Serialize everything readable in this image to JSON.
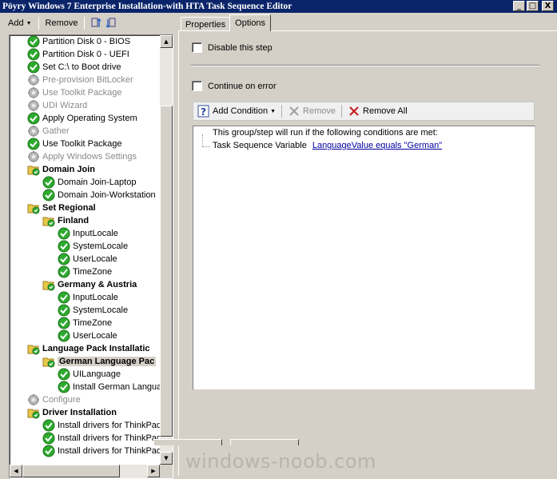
{
  "window": {
    "title": "Pöyry Windows 7 Enterprise Installation-with HTA Task Sequence Editor",
    "min_label": "_",
    "max_label": "□",
    "close_label": "X"
  },
  "toolbar": {
    "add_label": "Add",
    "remove_label": "Remove"
  },
  "tree": {
    "rows": [
      {
        "label": "Partition Disk 0 - BIOS",
        "icon": "check-icon",
        "indent": 0,
        "type": "step"
      },
      {
        "label": "Partition Disk 0 - UEFI",
        "icon": "check-icon",
        "indent": 0,
        "type": "step"
      },
      {
        "label": "Set C:\\ to Boot drive",
        "icon": "check-icon",
        "indent": 0,
        "type": "step"
      },
      {
        "label": "Pre-provision BitLocker",
        "icon": "disabled-gear-icon",
        "indent": 0,
        "type": "disabled"
      },
      {
        "label": "Use Toolkit Package",
        "icon": "disabled-gear-icon",
        "indent": 0,
        "type": "disabled"
      },
      {
        "label": "UDI Wizard",
        "icon": "disabled-gear-icon",
        "indent": 0,
        "type": "disabled"
      },
      {
        "label": "Apply Operating System",
        "icon": "check-icon",
        "indent": 0,
        "type": "step"
      },
      {
        "label": "Gather",
        "icon": "disabled-gear-icon",
        "indent": 0,
        "type": "disabled"
      },
      {
        "label": "Use Toolkit Package",
        "icon": "check-icon",
        "indent": 0,
        "type": "step"
      },
      {
        "label": "Apply Windows Settings",
        "icon": "disabled-gear-icon",
        "indent": 0,
        "type": "disabled"
      },
      {
        "label": "Domain Join",
        "icon": "folder-check-icon",
        "indent": 0,
        "type": "group"
      },
      {
        "label": "Domain Join-Laptop",
        "icon": "check-icon",
        "indent": 1,
        "type": "step"
      },
      {
        "label": "Domain Join-Workstation",
        "icon": "check-icon",
        "indent": 1,
        "type": "step"
      },
      {
        "label": "Set Regional",
        "icon": "folder-check-icon",
        "indent": 0,
        "type": "group"
      },
      {
        "label": "Finland",
        "icon": "folder-check-icon",
        "indent": 1,
        "type": "group"
      },
      {
        "label": "InputLocale",
        "icon": "check-icon",
        "indent": 2,
        "type": "step"
      },
      {
        "label": "SystemLocale",
        "icon": "check-icon",
        "indent": 2,
        "type": "step"
      },
      {
        "label": "UserLocale",
        "icon": "check-icon",
        "indent": 2,
        "type": "step"
      },
      {
        "label": "TimeZone",
        "icon": "check-icon",
        "indent": 2,
        "type": "step"
      },
      {
        "label": "Germany & Austria",
        "icon": "folder-check-icon",
        "indent": 1,
        "type": "group"
      },
      {
        "label": "InputLocale",
        "icon": "check-icon",
        "indent": 2,
        "type": "step"
      },
      {
        "label": "SystemLocale",
        "icon": "check-icon",
        "indent": 2,
        "type": "step"
      },
      {
        "label": "TimeZone",
        "icon": "check-icon",
        "indent": 2,
        "type": "step"
      },
      {
        "label": "UserLocale",
        "icon": "check-icon",
        "indent": 2,
        "type": "step"
      },
      {
        "label": "Language Pack Installatic",
        "icon": "folder-check-icon",
        "indent": 0,
        "type": "group"
      },
      {
        "label": "German Language Pac",
        "icon": "folder-check-icon",
        "indent": 1,
        "type": "group",
        "selected": true
      },
      {
        "label": "UILanguage",
        "icon": "check-icon",
        "indent": 2,
        "type": "step"
      },
      {
        "label": "Install German Langua",
        "icon": "check-icon",
        "indent": 2,
        "type": "step"
      },
      {
        "label": "Configure",
        "icon": "disabled-gear-icon",
        "indent": 0,
        "type": "disabled"
      },
      {
        "label": "Driver Installation",
        "icon": "folder-check-icon",
        "indent": 0,
        "type": "group"
      },
      {
        "label": "Install drivers for ThinkPad",
        "icon": "check-icon",
        "indent": 1,
        "type": "step"
      },
      {
        "label": "Install drivers for ThinkPad",
        "icon": "check-icon",
        "indent": 1,
        "type": "step"
      },
      {
        "label": "Install drivers for ThinkPad",
        "icon": "check-icon",
        "indent": 1,
        "type": "step"
      }
    ]
  },
  "tabs": [
    {
      "label": "Properties",
      "active": false
    },
    {
      "label": "Options",
      "active": true
    }
  ],
  "options": {
    "disable_step_label": "Disable this step",
    "disable_step_checked": false,
    "continue_on_error_label": "Continue on error",
    "continue_on_error_checked": false,
    "add_condition_label": "Add Condition",
    "remove_label": "Remove",
    "remove_all_label": "Remove All",
    "condition_header": "This group/step will run if the following conditions are met:",
    "condition_type": "Task Sequence Variable",
    "condition_value": "LanguageValue equals \"German\""
  },
  "watermark": "windows-noob.com",
  "colors": {
    "titlebar": "#0a246a",
    "check_green": "#2eaa2e",
    "folder_yellow": "#e8c84a",
    "link": "#0000a0"
  }
}
